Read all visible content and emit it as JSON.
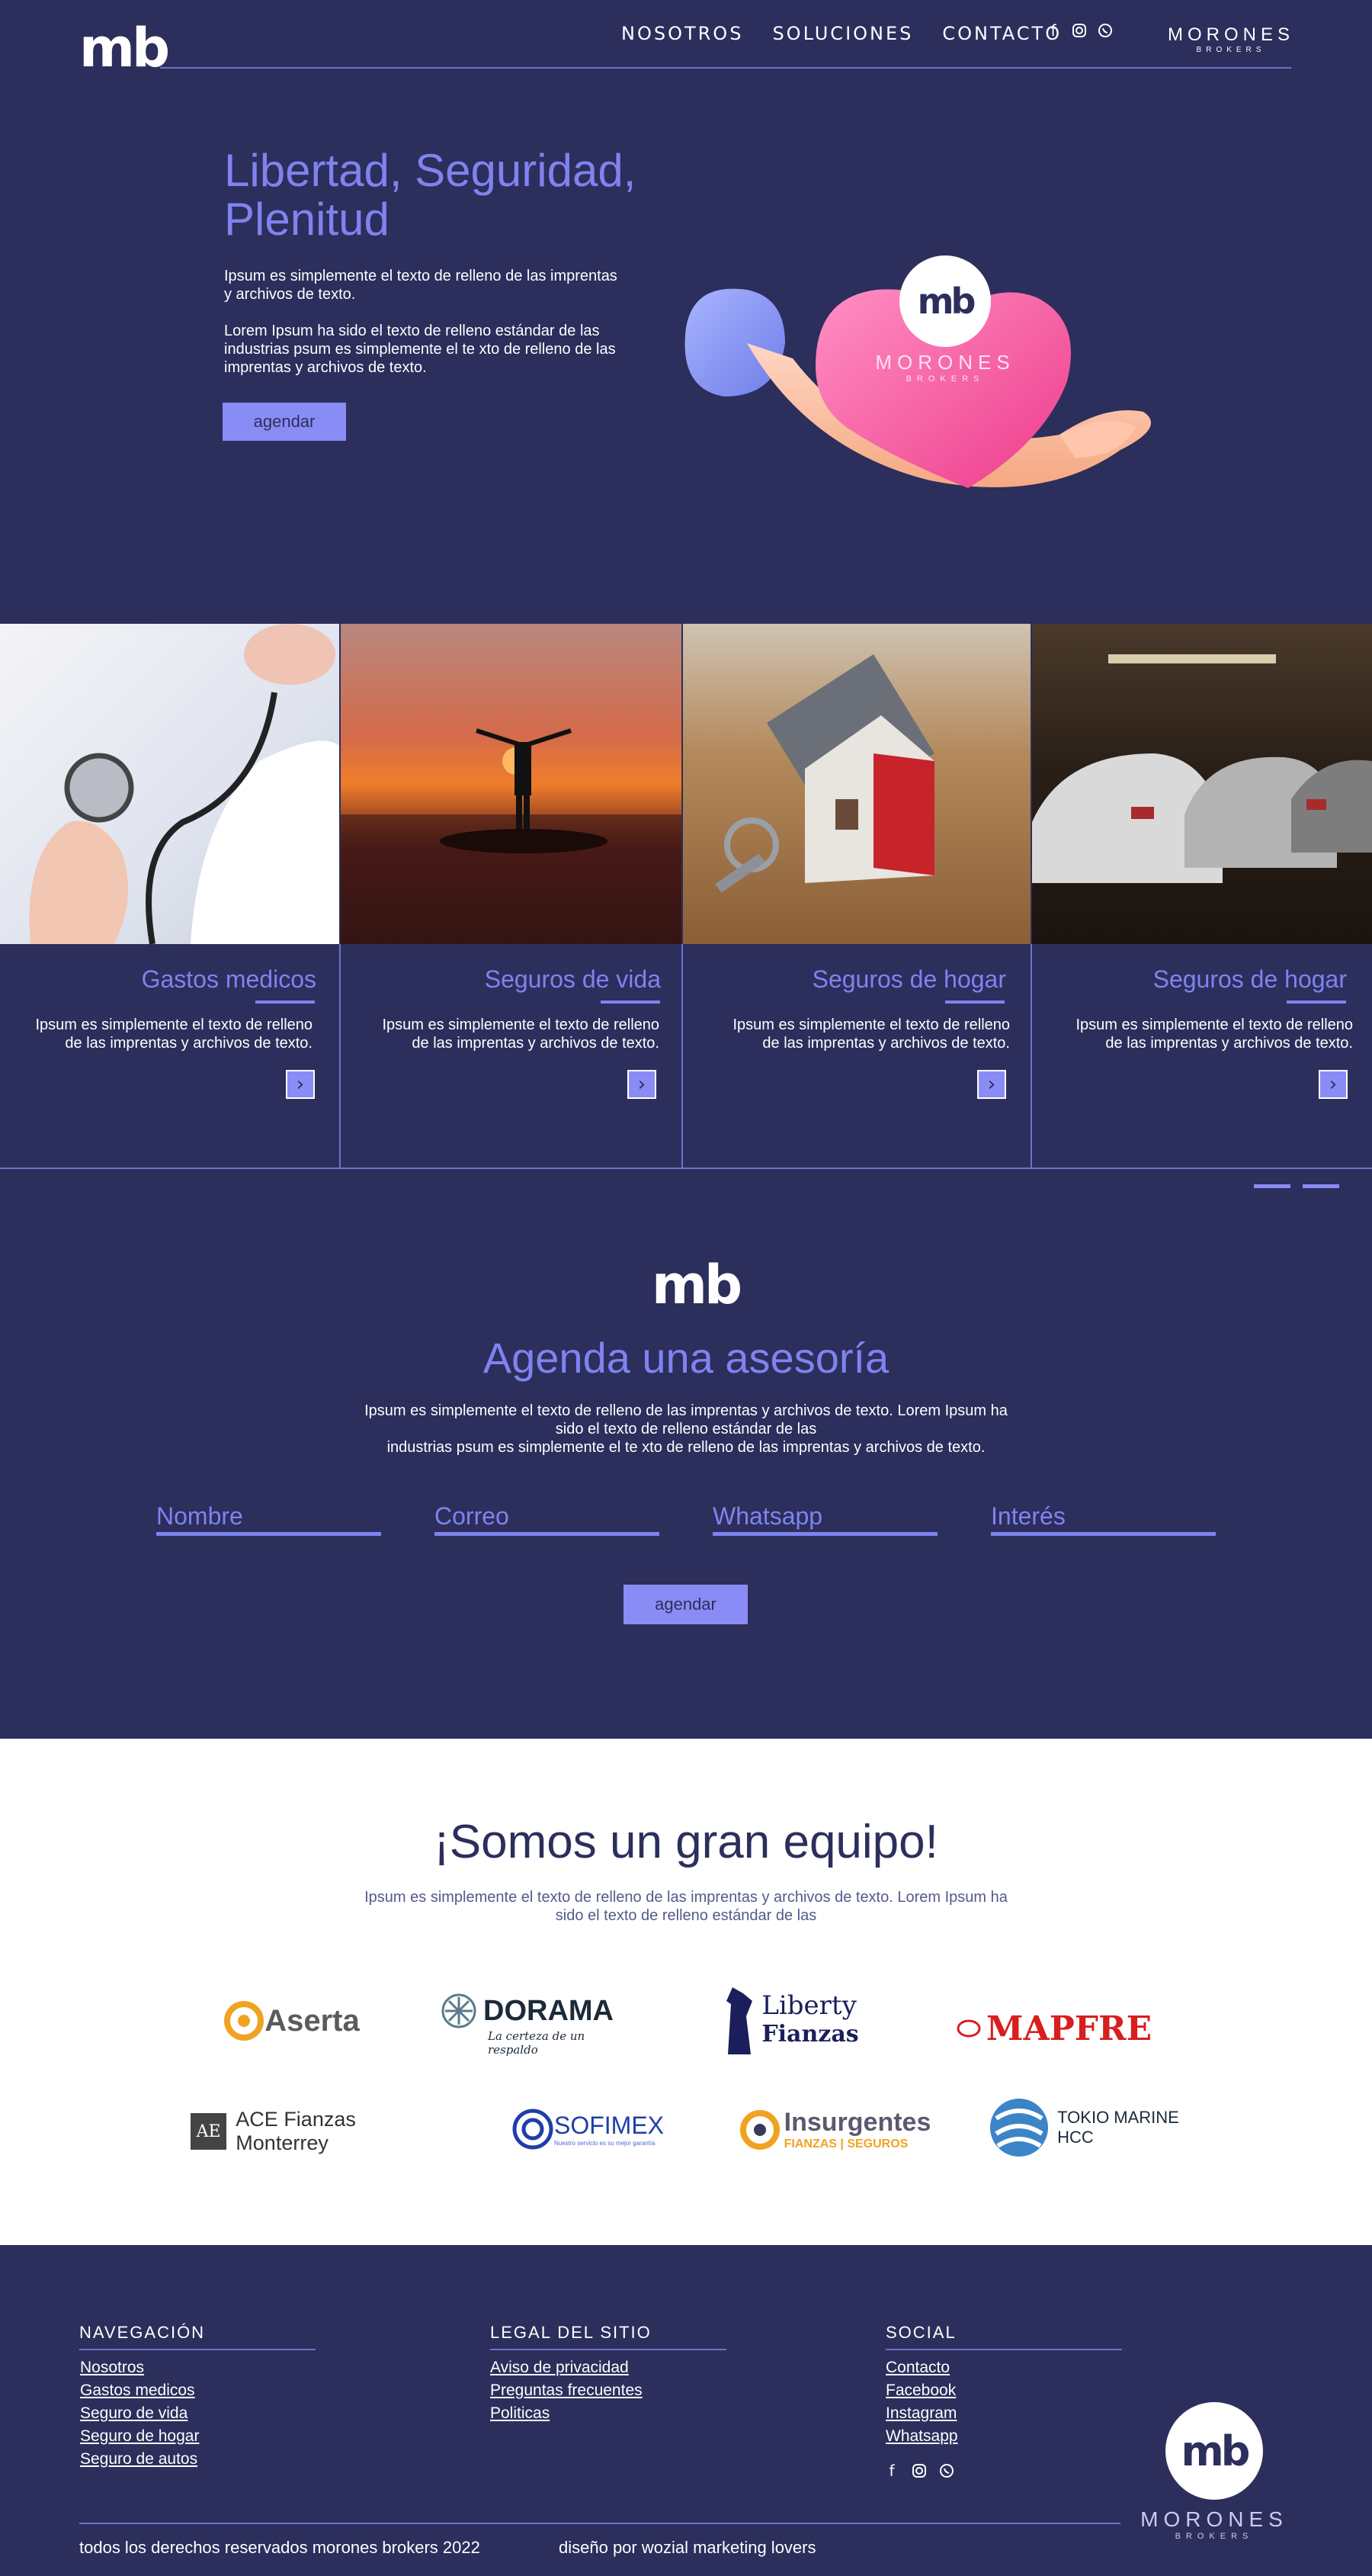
{
  "header": {
    "logo_text": "mb",
    "nav": [
      "NOSOTROS",
      "SOLUCIONES",
      "CONTACTO"
    ],
    "social_icons": [
      "facebook-icon",
      "instagram-icon",
      "whatsapp-icon"
    ],
    "brand_name": "MORONES",
    "brand_sub": "BROKERS"
  },
  "hero": {
    "title_line1": "Libertad, Seguridad,",
    "title_line2": "Plenitud",
    "text1_line1": "Ipsum es simplemente el texto de  relleno de las imprentas",
    "text1_line2": "y  archivos de texto.",
    "text2_line1": "Lorem Ipsum ha sido el texto de relleno estándar de las",
    "text2_line2": "industrias psum es simplemente el te xto de relleno de las",
    "text2_line3": "imprentas y archivos de texto.",
    "button": "agendar",
    "heart_brand": "MORONES",
    "heart_sub": "BROKERS"
  },
  "services": [
    {
      "title": "Gastos medicos",
      "line1": "Ipsum es simplemente el texto de  relleno",
      "line2": "de las imprentas y  archivos de texto."
    },
    {
      "title": "Seguros de vida",
      "line1": "Ipsum es simplemente el texto de  relleno",
      "line2": "de las imprentas y  archivos de texto."
    },
    {
      "title": "Seguros de hogar",
      "line1": "Ipsum es simplemente el texto de  relleno",
      "line2": "de las imprentas y  archivos de texto."
    },
    {
      "title": "Seguros de hogar",
      "line1": "Ipsum es simplemente el texto de  relleno",
      "line2": "de las imprentas y  archivos de texto."
    }
  ],
  "agenda": {
    "logo_text": "mb",
    "title": "Agenda una asesoría",
    "line1": "Ipsum es simplemente el texto de  relleno de las imprentas y  archivos de texto. Lorem Ipsum ha",
    "line2": "sido el texto de relleno estándar de las",
    "line3": "industrias psum es simplemente el te xto de relleno de las imprentas y archivos de texto.",
    "fields": [
      "Nombre",
      "Correo",
      "Whatsapp",
      "Interés"
    ],
    "button": "agendar"
  },
  "team": {
    "title": "¡Somos un gran equipo!",
    "line1": "Ipsum es simplemente el texto de  relleno de las imprentas y  archivos de texto. Lorem Ipsum ha",
    "line2": "sido el texto de relleno estándar de las",
    "partners": {
      "aserta": "Aserta",
      "dorama": "DORAMA",
      "dorama_tag": "La certeza de un respaldo",
      "liberty1": "Liberty",
      "liberty2": "Fianzas",
      "mapfre": "MAPFRE",
      "ace": "ACE Fianzas Monterrey",
      "sofimex": "SOFIMEX",
      "sofimex_tag": "Nuestro servicio es su mejor garantía",
      "insurgentes": "Insurgentes",
      "insurgentes_tag": "FIANZAS | SEGUROS",
      "tokio1": "TOKIO MARINE",
      "tokio2": "HCC"
    }
  },
  "footer": {
    "nav_title": "NAVEGACIÓN",
    "nav_links": [
      "Nosotros",
      "Gastos medicos",
      "Seguro de vida",
      "Seguro de hogar",
      "Seguro de autos"
    ],
    "legal_title": "LEGAL DEL SITIO",
    "legal_links": [
      "Aviso de privacidad",
      "Preguntas frecuentes",
      "Politicas"
    ],
    "social_title": "SOCIAL",
    "social_links": [
      "Contacto",
      "Facebook",
      "Instagram",
      "Whatsapp"
    ],
    "logo_text": "mb",
    "brand_name": "MORONES",
    "brand_sub": "BROKERS",
    "copyright": "todos los derechos reservados morones brokers 2022",
    "credit": "diseño por wozial marketing lovers"
  },
  "colors": {
    "navy": "#2c2e5c",
    "accent": "#7f83ef",
    "button": "#8a8cf5"
  }
}
